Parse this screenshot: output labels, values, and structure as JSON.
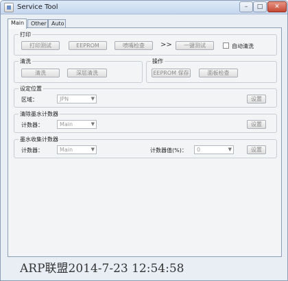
{
  "window": {
    "title": "Service Tool",
    "minimize_glyph": "–",
    "maximize_glyph": "□",
    "close_glyph": "✕"
  },
  "tabs": [
    {
      "label": "Main",
      "active": true
    },
    {
      "label": "Other",
      "active": false
    },
    {
      "label": "Auto",
      "active": false
    }
  ],
  "print_group": {
    "title": "打印",
    "print_test_label": "打印测试",
    "eeprom_label": "EEPROM",
    "nozzle_check_label": "喷嘴检查",
    "arrow_text": ">>",
    "one_key_test_label": "一键测试",
    "auto_clean_label": "自动清洗"
  },
  "clean_group": {
    "title": "清洗",
    "clean_label": "清洗",
    "deep_clean_label": "深层清洗"
  },
  "operation_group": {
    "title": "操作",
    "eeprom_save_label": "EEPROM 保存",
    "panel_check_label": "面板检查"
  },
  "destination_group": {
    "title": "设定位置",
    "region_label": "区域：",
    "region_value": "JPN",
    "set_label": "设置"
  },
  "ink_counter_group": {
    "title": "清除墨水计数器",
    "counter_label": "计数器：",
    "counter_value": "Main",
    "set_label": "设置"
  },
  "waste_counter_group": {
    "title": "墨水收集计数器",
    "counter_label": "计数器：",
    "counter_value": "Main",
    "counter_value_label": "计数器值(%)：",
    "counter_value_select": "0",
    "set_label": "设置"
  },
  "watermark": "ARP联盟2014-7-23 12:54:58"
}
